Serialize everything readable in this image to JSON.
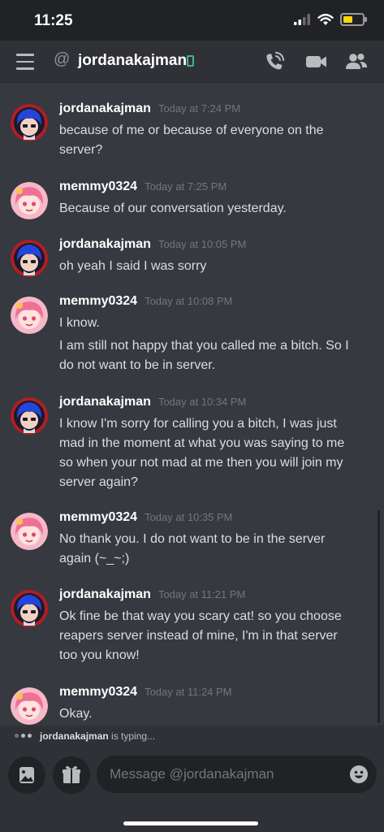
{
  "status_bar": {
    "time": "11:25",
    "battery_level": 0.5
  },
  "header": {
    "at_symbol": "@",
    "title": "jordanakajman"
  },
  "messages": [
    {
      "author": "jordanakajman",
      "avatar": "blue-hair-avatar",
      "timestamp": "Today at 7:24 PM",
      "lines": [
        "because of me or because of everyone on the",
        "server?"
      ]
    },
    {
      "author": "memmy0324",
      "avatar": "pink-hair-avatar",
      "timestamp": "Today at 7:25 PM",
      "lines": [
        "Because of our conversation yesterday."
      ]
    },
    {
      "author": "jordanakajman",
      "avatar": "blue-hair-avatar",
      "timestamp": "Today at 10:05 PM",
      "lines": [
        "oh yeah I said I was sorry"
      ]
    },
    {
      "author": "memmy0324",
      "avatar": "pink-hair-avatar",
      "timestamp": "Today at 10:08 PM",
      "lines": [
        "I know.",
        "I am still not happy that you called me a bitch. So I",
        "do not want to be in server."
      ]
    },
    {
      "author": "jordanakajman",
      "avatar": "blue-hair-avatar",
      "timestamp": "Today at 10:34 PM",
      "lines": [
        "I know I'm sorry for calling you a bitch, I was just",
        "mad in the moment at what you was saying to me",
        "so when your not mad at me then you will join my",
        "server again?"
      ]
    },
    {
      "author": "memmy0324",
      "avatar": "pink-hair-avatar",
      "timestamp": "Today at 10:35 PM",
      "lines": [
        "No thank you. I do not want to be in the server",
        "again (~_~;)"
      ]
    },
    {
      "author": "jordanakajman",
      "avatar": "blue-hair-avatar",
      "timestamp": "Today at 11:21 PM",
      "lines": [
        "Ok fine be that way you scary cat! so you choose",
        "reapers server instead of mine, I'm in that server",
        "too you know!"
      ]
    },
    {
      "author": "memmy0324",
      "avatar": "pink-hair-avatar",
      "timestamp": "Today at 11:24 PM",
      "lines": [
        "Okay."
      ]
    }
  ],
  "typing": {
    "user": "jordanakajman",
    "suffix": " is typing..."
  },
  "composer": {
    "placeholder": "Message @jordanakajman"
  },
  "colors": {
    "background": "#36393f",
    "header": "#2f3136",
    "online_green": "#43b581",
    "battery_yellow": "#ffd60a"
  }
}
